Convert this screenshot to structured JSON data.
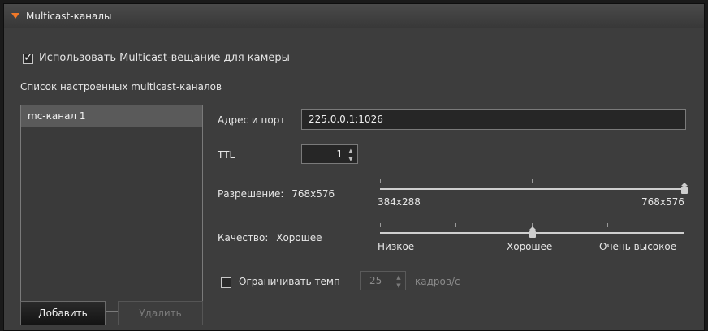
{
  "header": {
    "title": "Multicast-каналы",
    "accent": "#f07828"
  },
  "use_multicast": {
    "label": "Использовать Multicast-вещание для камеры",
    "checked": true
  },
  "list_title": "Список настроенных multicast-каналов",
  "channels": [
    {
      "name": "mc-канал 1",
      "selected": true
    }
  ],
  "buttons": {
    "add": "Добавить",
    "delete": "Удалить"
  },
  "address": {
    "label": "Адрес и порт",
    "value": "225.0.0.1:1026"
  },
  "ttl": {
    "label": "TTL",
    "value": "1",
    "up_icon": "▲",
    "down_icon": "▼"
  },
  "resolution": {
    "label": "Разрешение:",
    "value": "768x576",
    "min_label": "384x288",
    "max_label": "768x576",
    "level": 1.0
  },
  "quality": {
    "label": "Качество:",
    "value": "Хорошее",
    "ticks": [
      "Низкое",
      "Хорошее",
      "Очень высокое"
    ],
    "level": 0.5
  },
  "fps_limit": {
    "label": "Ограничивать темп",
    "checked": false,
    "value": "25",
    "unit": "кадров/с"
  }
}
